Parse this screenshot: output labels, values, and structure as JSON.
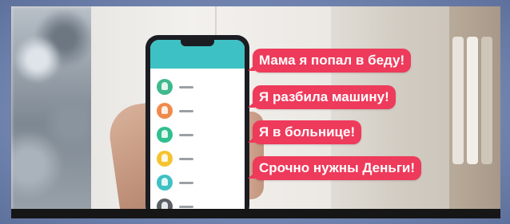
{
  "phone": {
    "colors": {
      "accent": "#3ec1c4"
    },
    "contacts": [
      {
        "avatar_color": "#3fb98c"
      },
      {
        "avatar_color": "#f08a4b"
      },
      {
        "avatar_color": "#2fbf8f"
      },
      {
        "avatar_color": "#f4c430"
      },
      {
        "avatar_color": "#3ec1c4"
      },
      {
        "avatar_color": "#5b5f66"
      }
    ]
  },
  "messages": [
    {
      "text": "Мама я попал в беду!"
    },
    {
      "text": "Я разбила машину!"
    },
    {
      "text": "Я в больнице!"
    },
    {
      "text": "Срочно нужны Деньги!"
    }
  ],
  "colors": {
    "bubble": "#ee3a5b",
    "frame": "#7d8fb6"
  }
}
